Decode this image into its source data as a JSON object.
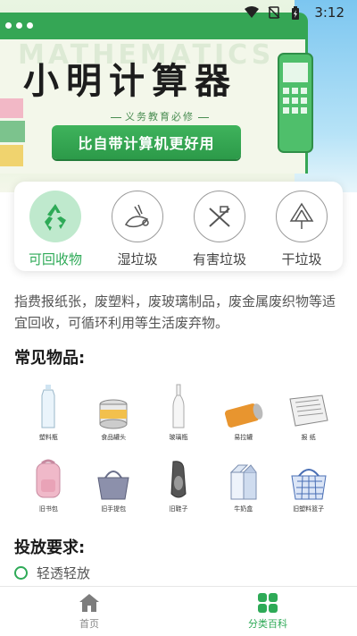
{
  "status_bar": {
    "time": "3:12"
  },
  "banner": {
    "title": "小明计算器",
    "watermark": "MATHEMATICS",
    "subtitle": "义务教育必修",
    "cta": "比自带计算机更好用"
  },
  "categories": [
    {
      "label": "可回收物",
      "icon": "recycle-icon",
      "active": true
    },
    {
      "label": "湿垃圾",
      "icon": "wet-waste-icon",
      "active": false
    },
    {
      "label": "有害垃圾",
      "icon": "hazardous-waste-icon",
      "active": false
    },
    {
      "label": "干垃圾",
      "icon": "dry-waste-icon",
      "active": false
    }
  ],
  "description": "指费报纸张，废塑料，废玻璃制品，废金属废织物等适宜回收，可循环利用等生活废弃物。",
  "common_items": {
    "title": "常见物品:",
    "items": [
      {
        "caption": "塑料瓶",
        "icon": "plastic-bottle-icon"
      },
      {
        "caption": "食品罐头",
        "icon": "food-can-icon"
      },
      {
        "caption": "玻璃瓶",
        "icon": "glass-bottle-icon"
      },
      {
        "caption": "易拉罐",
        "icon": "soda-can-icon"
      },
      {
        "caption": "报 纸",
        "icon": "newspaper-icon"
      },
      {
        "caption": "旧书包",
        "icon": "backpack-icon"
      },
      {
        "caption": "旧手提包",
        "icon": "handbag-icon"
      },
      {
        "caption": "旧鞋子",
        "icon": "shoe-icon"
      },
      {
        "caption": "牛奶盒",
        "icon": "milk-carton-icon"
      },
      {
        "caption": "旧塑料篮子",
        "icon": "plastic-basket-icon"
      }
    ]
  },
  "requirements": {
    "title": "投放要求:",
    "items": [
      "轻透轻放"
    ]
  },
  "tabbar": {
    "tabs": [
      {
        "label": "首页",
        "icon": "home-icon",
        "active": false
      },
      {
        "label": "分类百科",
        "icon": "grid-icon",
        "active": true
      }
    ]
  },
  "colors": {
    "accent": "#2eaa57",
    "banner_green": "#35a655"
  }
}
